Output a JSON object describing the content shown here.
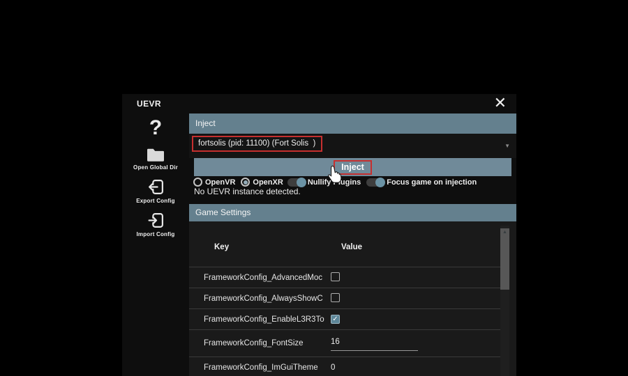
{
  "colors": {
    "accent_bar": "#64808e",
    "highlight_red": "#c62f2f",
    "toggle_on": "#6b93a5"
  },
  "window": {
    "title": "UEVR",
    "close_glyph": "✕"
  },
  "sidebar": {
    "help_glyph": "?",
    "items": [
      {
        "label": "Open Global Dir",
        "icon": "folder"
      },
      {
        "label": "Export Config",
        "icon": "export"
      },
      {
        "label": "Import Config",
        "icon": "import"
      }
    ]
  },
  "inject_panel": {
    "header": "Inject",
    "process_dropdown": {
      "value": "fortsolis (pid: 11100) (Fort Solis  )",
      "arrow_glyph": "▼"
    },
    "inject_button": "Inject",
    "runtime_options": [
      {
        "type": "radio",
        "label": "OpenVR",
        "selected": false
      },
      {
        "type": "radio",
        "label": "OpenXR",
        "selected": true
      },
      {
        "type": "toggle",
        "label": "Nullify Plugins",
        "on": true
      },
      {
        "type": "toggle",
        "label": "Focus game on injection",
        "on": true
      }
    ],
    "status": "No UEVR instance detected."
  },
  "game_settings": {
    "header": "Game Settings",
    "columns": {
      "key": "Key",
      "value": "Value"
    },
    "rows": [
      {
        "key": "FrameworkConfig_AdvancedMoc",
        "type": "checkbox",
        "checked": false
      },
      {
        "key": "FrameworkConfig_AlwaysShowC",
        "type": "checkbox",
        "checked": false
      },
      {
        "key": "FrameworkConfig_EnableL3R3To",
        "type": "checkbox",
        "checked": true
      },
      {
        "key": "FrameworkConfig_FontSize",
        "type": "text",
        "value": "16"
      },
      {
        "key": "FrameworkConfig_ImGuiTheme",
        "type": "number",
        "value": "0"
      }
    ],
    "scrollbar_arrow": "▲",
    "check_glyph": "✓"
  }
}
